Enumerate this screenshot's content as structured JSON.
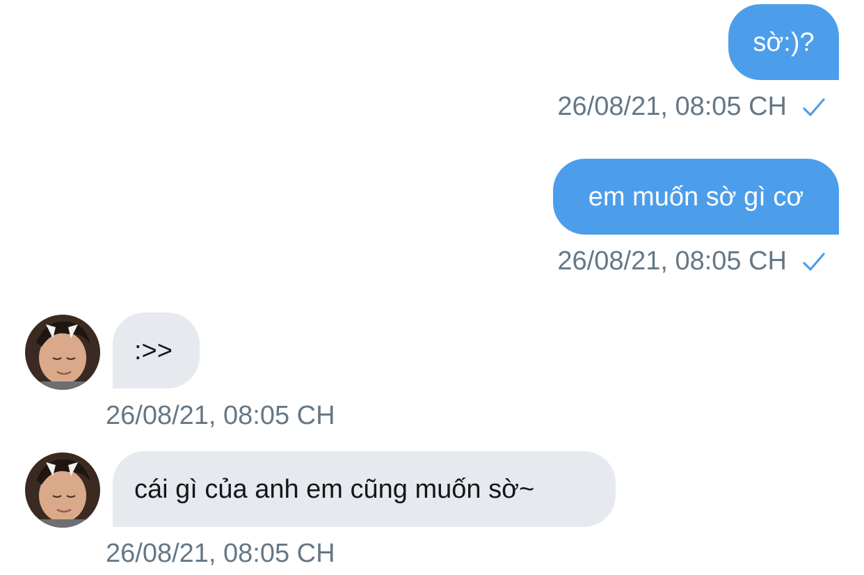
{
  "messages": [
    {
      "direction": "outgoing",
      "text": "sờ:)?",
      "timestamp": "26/08/21, 08:05 CH",
      "status_icon": "check-icon"
    },
    {
      "direction": "outgoing",
      "text": "em muốn sờ gì cơ",
      "timestamp": "26/08/21, 08:05 CH",
      "status_icon": "check-icon"
    },
    {
      "direction": "incoming",
      "text": ":>>",
      "timestamp": "26/08/21, 08:05 CH",
      "avatar": "avatar-photo"
    },
    {
      "direction": "incoming",
      "text": "cái gì của anh em cũng muốn sờ~",
      "timestamp": "26/08/21, 08:05 CH",
      "avatar": "avatar-photo"
    }
  ],
  "colors": {
    "outgoing_bubble": "#4c9eea",
    "incoming_bubble": "#e6e9ee",
    "timestamp_text": "#657786",
    "check_icon": "#4c9eea"
  }
}
